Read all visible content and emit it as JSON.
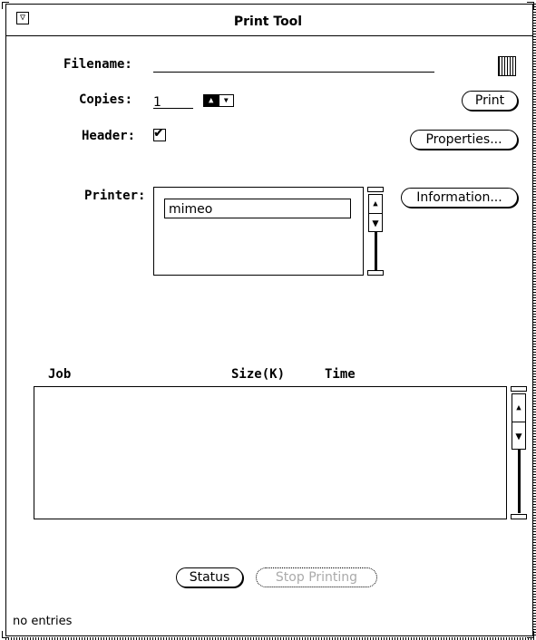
{
  "window": {
    "title": "Print Tool",
    "menu_glyph": "▽"
  },
  "form": {
    "filename_label": "Filename:",
    "filename_value": "",
    "copies_label": "Copies:",
    "copies_value": "1",
    "header_label": "Header:",
    "header_checked": true,
    "printer_label": "Printer:",
    "printer_selected": "mimeo"
  },
  "buttons": {
    "print": "Print",
    "properties": "Properties...",
    "information": "Information...",
    "status": "Status",
    "stop_printing": "Stop Printing"
  },
  "queue": {
    "columns": [
      "Job",
      "Size(K)",
      "Time"
    ],
    "rows": []
  },
  "footer": {
    "message": "no entries"
  }
}
